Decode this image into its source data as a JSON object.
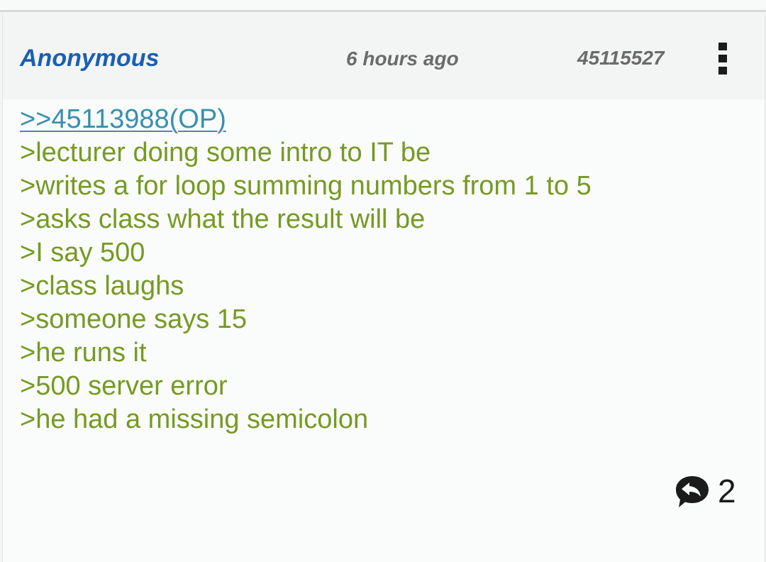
{
  "post": {
    "author": "Anonymous",
    "timestamp": "6 hours ago",
    "post_number": "45115527",
    "reply_link": ">>45113988(OP)",
    "lines": [
      ">lecturer doing some intro to IT be",
      ">writes a for loop summing numbers from 1 to 5",
      ">asks class what the result will be",
      ">I say 500",
      ">class laughs",
      ">someone says 15",
      ">he runs it",
      ">500 server error",
      ">he had a missing semicolon"
    ],
    "reply_count": "2"
  },
  "icons": {
    "menu": "more-vertical-icon",
    "reply": "reply-bubble-icon"
  },
  "colors": {
    "author": "#1a5fb4",
    "meta": "#6b6b6b",
    "link": "#3a8fb0",
    "greentext": "#789922",
    "header_bg": "#f3f4f4",
    "body_bg": "#f9fcfb"
  }
}
